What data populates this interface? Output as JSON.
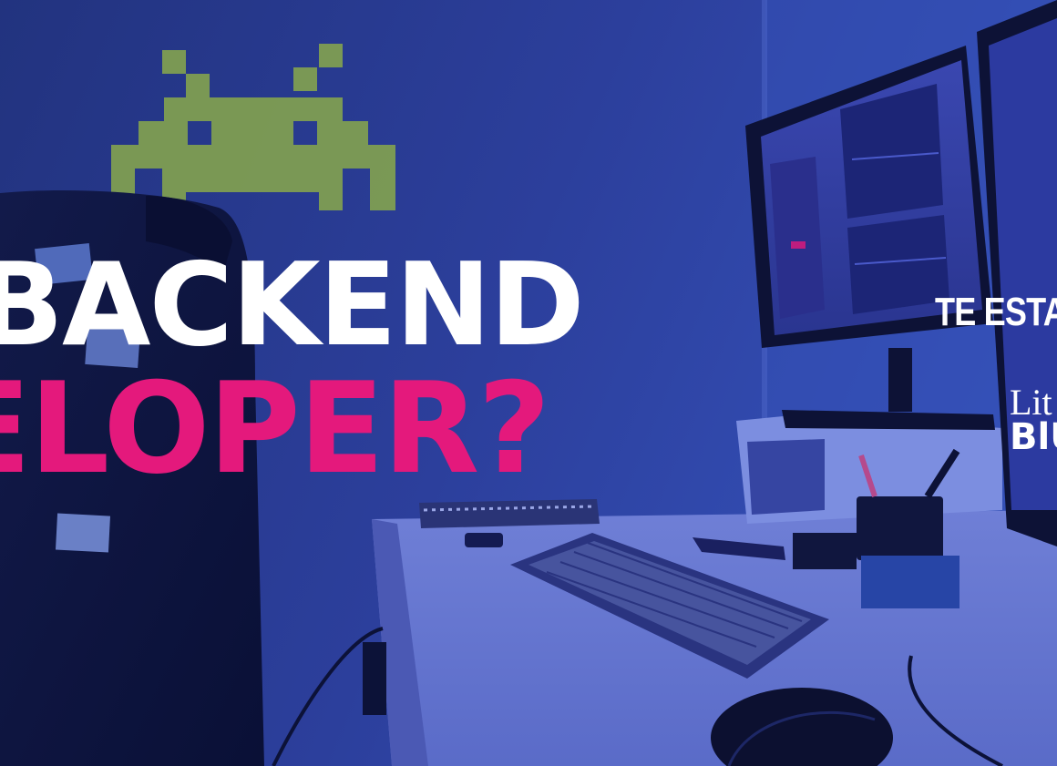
{
  "headline": {
    "line1": "BACKEND",
    "line2": "ELOPER?"
  },
  "tagline": "TE ESTA",
  "brand": {
    "top": "Lit",
    "bottom": "BlU"
  },
  "colors": {
    "background_tint": "#2b3a9c",
    "headline_white": "#ffffff",
    "headline_pink": "#e4197c",
    "invader_green": "#7f9e52"
  },
  "icons": [
    "space-invader-icon"
  ]
}
